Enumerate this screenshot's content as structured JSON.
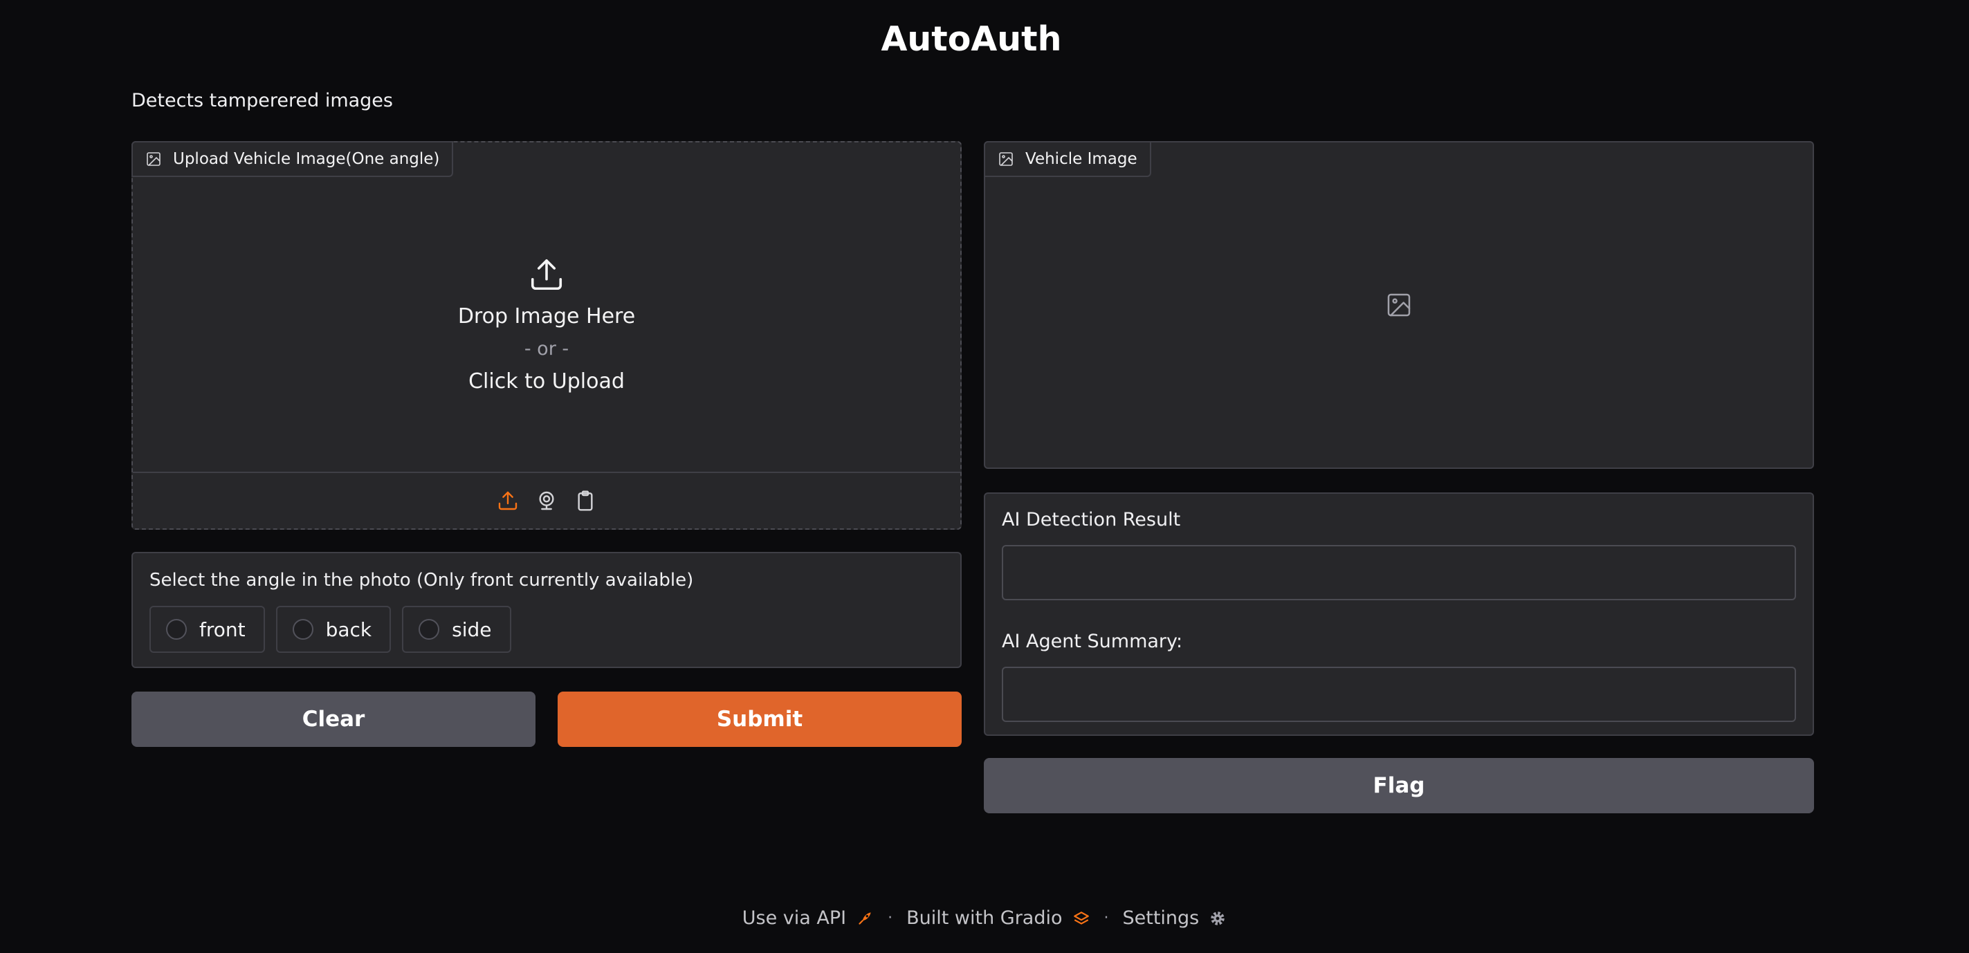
{
  "app": {
    "title": "AutoAuth",
    "description": "Detects tamperered images"
  },
  "upload_panel": {
    "label": "Upload Vehicle Image(One angle)",
    "label_icon": "image-icon",
    "drop_text": "Drop Image Here",
    "or_text": "- or -",
    "click_text": "Click to Upload",
    "sources": [
      {
        "name": "upload",
        "icon": "upload-icon",
        "active": true
      },
      {
        "name": "webcam",
        "icon": "webcam-icon",
        "active": false
      },
      {
        "name": "clipboard",
        "icon": "clipboard-icon",
        "active": false
      }
    ]
  },
  "angle_select": {
    "label": "Select the angle in the photo (Only front currently available)",
    "options": [
      "front",
      "back",
      "side"
    ],
    "selected": null
  },
  "actions": {
    "clear_label": "Clear",
    "submit_label": "Submit",
    "flag_label": "Flag"
  },
  "output_image": {
    "label": "Vehicle Image",
    "label_icon": "image-icon"
  },
  "results": {
    "detection_label": "AI Detection Result",
    "detection_value": "",
    "summary_label": "AI Agent Summary:",
    "summary_value": ""
  },
  "footer": {
    "api_label": "Use via API",
    "built_label": "Built with Gradio",
    "settings_label": "Settings",
    "separator": "·"
  },
  "colors": {
    "background": "#0b0b0d",
    "panel": "#27272a",
    "border": "#3f3f46",
    "primary": "#e0652b",
    "secondary": "#52525b",
    "accent_icon": "#f97316"
  }
}
